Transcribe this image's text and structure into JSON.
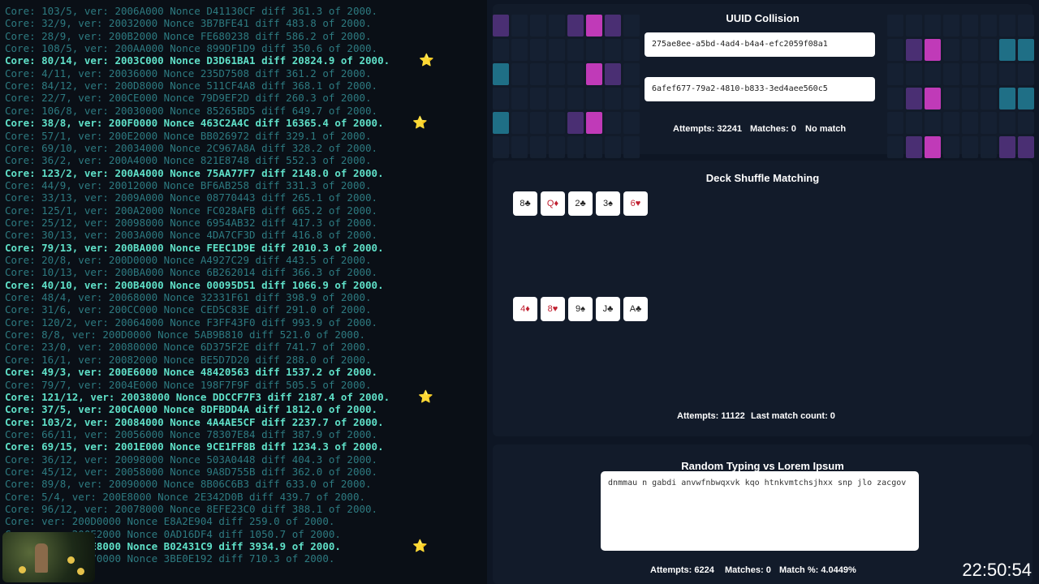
{
  "log": {
    "lines": [
      "Core: 103/5, ver: 2006A000 Nonce D41130CF diff 361.3 of 2000.",
      "Core: 32/9, ver: 20032000 Nonce 3B7BFE41 diff 483.8 of 2000.",
      "Core: 28/9, ver: 200B2000 Nonce FE680238 diff 586.2 of 2000.",
      "Core: 108/5, ver: 200AA000 Nonce 899DF1D9 diff 350.6 of 2000.",
      "Core: 80/14, ver: 2003C000 Nonce D3D61BA1 diff 20824.9 of 2000.",
      "Core: 4/11, ver: 20036000 Nonce 235D7508 diff 361.2 of 2000.",
      "Core: 84/12, ver: 200D8000 Nonce 511CF4A8 diff 368.1 of 2000.",
      "Core: 22/7, ver: 200CE000 Nonce 79D9EF2D diff 260.3 of 2000.",
      "Core: 106/8, ver: 20030000 Nonce 85265BD5 diff 649.7 of 2000.",
      "Core: 38/8, ver: 200F0000 Nonce 463C2A4C diff 16365.4 of 2000.",
      "Core: 57/1, ver: 200E2000 Nonce BB026972 diff 329.1 of 2000.",
      "Core: 69/10, ver: 20034000 Nonce 2C967A8A diff 328.2 of 2000.",
      "Core: 36/2, ver: 200A4000 Nonce 821E8748 diff 552.3 of 2000.",
      "Core: 123/2, ver: 200A4000 Nonce 75AA77F7 diff 2148.0 of 2000.",
      "Core: 44/9, ver: 20012000 Nonce BF6AB258 diff 331.3 of 2000.",
      "Core: 33/13, ver: 2009A000 Nonce 08770443 diff 265.1 of 2000.",
      "Core: 125/1, ver: 200A2000 Nonce FC028AFB diff 665.2 of 2000.",
      "Core: 25/12, ver: 20098000 Nonce 6954AB32 diff 417.3 of 2000.",
      "Core: 30/13, ver: 2003A000 Nonce 4DA7CF3D diff 416.8 of 2000.",
      "Core: 79/13, ver: 200BA000 Nonce FEEC1D9E diff 2010.3 of 2000.",
      "Core: 20/8, ver: 200D0000 Nonce A4927C29 diff 443.5 of 2000.",
      "Core: 10/13, ver: 200BA000 Nonce 6B262014 diff 366.3 of 2000.",
      "Core: 40/10, ver: 200B4000 Nonce 00095D51 diff 1066.9 of 2000.",
      "Core: 48/4, ver: 20068000 Nonce 32331F61 diff 398.9 of 2000.",
      "Core: 31/6, ver: 200CC000 Nonce CED5C83E diff 291.0 of 2000.",
      "Core: 120/2, ver: 20064000 Nonce F3FF43F0 diff 993.9 of 2000.",
      "Core: 8/8, ver: 200D0000 Nonce 5AB9B810 diff 521.0 of 2000.",
      "Core: 23/0, ver: 20080000 Nonce 6D375F2E diff 741.7 of 2000.",
      "Core: 16/1, ver: 20082000 Nonce BE5D7D20 diff 288.0 of 2000.",
      "Core: 49/3, ver: 200E6000 Nonce 48420563 diff 1537.2 of 2000.",
      "Core: 79/7, ver: 2004E000 Nonce 198F7F9F diff 505.5 of 2000.",
      "Core: 121/12, ver: 20038000 Nonce DDCCF7F3 diff 2187.4 of 2000.",
      "Core: 37/5, ver: 200CA000 Nonce 8DFBDD4A diff 1812.0 of 2000.",
      "Core: 103/2, ver: 20084000 Nonce 4A4AE5CF diff 2237.7 of 2000.",
      "Core: 66/11, ver: 20056000 Nonce 78307E84 diff 387.9 of 2000.",
      "Core: 69/15, ver: 2001E000 Nonce 9CE1FF8B diff 1234.3 of 2000.",
      "Core: 36/12, ver: 20098000 Nonce 503A0448 diff 404.3 of 2000.",
      "Core: 45/12, ver: 20058000 Nonce 9A8D755B diff 362.0 of 2000.",
      "Core: 89/8, ver: 20090000 Nonce 8B06C6B3 diff 633.0 of 2000.",
      "Core: 5/4, ver: 200E8000 Nonce 2E342D0B diff 439.7 of 2000.",
      "Core: 96/12, ver: 20078000 Nonce 8EFE23C0 diff 388.1 of 2000.",
      "Core: ver: 200D0000 Nonce E8A2E904 diff 259.0 of 2000.",
      "Core: ver: 200E2000 Nonce 0AD16DF4 diff 1050.7 of 2000.",
      "Core: ver: 200E8000 Nonce B02431C9 diff 3934.9 of 2000.",
      "Core: ver: 20070000 Nonce 3BE0E192 diff 710.3 of 2000."
    ],
    "highlighted": [
      4,
      9,
      13,
      19,
      22,
      29,
      31,
      32,
      33,
      35,
      43
    ],
    "starred": [
      4,
      9,
      31,
      43
    ],
    "star_glyph": "⭐"
  },
  "uuid": {
    "title": "UUID Collision",
    "uuid1": "275ae8ee-a5bd-4ad4-b4a4-efc2059f08a1",
    "uuid2": "6afef677-79a2-4810-b833-3ed4aee560c5",
    "attempts_label": "Attempts: 32241",
    "matches_label": "Matches: 0",
    "status_label": "No match",
    "colors": {
      "magenta": "#c03ab8",
      "purple": "#4a2f73",
      "teal": "#1f6f86",
      "dark": "#162133"
    }
  },
  "deck": {
    "title": "Deck Shuffle Matching",
    "row1": [
      "8♣",
      "Q♦",
      "2♣",
      "3♠",
      "6♥"
    ],
    "row2": [
      "4♦",
      "8♥",
      "9♠",
      "J♣",
      "A♣"
    ],
    "attempts_label": "Attempts: 11122",
    "last_match_label": "Last match count: 0"
  },
  "typing": {
    "title": "Random Typing vs Lorem Ipsum",
    "text": "dnmmau n gabdi anvwfnbwqxvk kqo htnkvmtchsjhxx snp jlo zacgov",
    "attempts_label": "Attempts: 6224",
    "matches_label": "Matches: 0",
    "pct_label": "Match %: 4.0449%"
  },
  "clock": "22:50:54"
}
